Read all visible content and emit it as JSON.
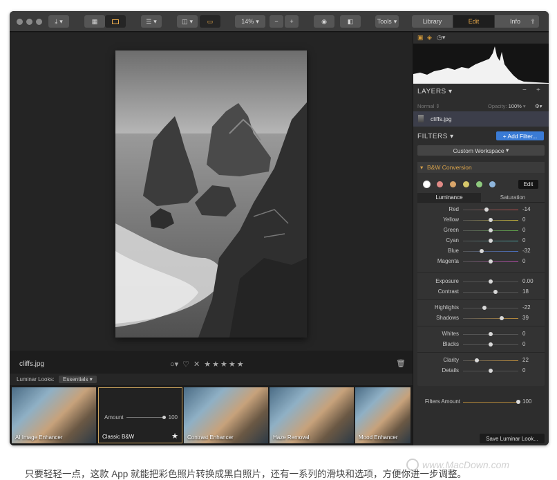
{
  "toolbar": {
    "zoom": "14%",
    "tools_label": "Tools",
    "view_tabs": [
      "Library",
      "Edit",
      "Info"
    ],
    "active_view": "Edit"
  },
  "photo": {
    "filename": "cliffs.jpg",
    "stars": 5
  },
  "looks": {
    "label": "Luminar Looks:",
    "category": "Essentials",
    "items": [
      {
        "name": "AI Image Enhancer",
        "type": "color"
      },
      {
        "name": "Classic B&W",
        "type": "bw",
        "amount_label": "Amount",
        "amount_value": "100",
        "favorite": true
      },
      {
        "name": "Contrast Enhancer",
        "type": "color"
      },
      {
        "name": "Haze Removal",
        "type": "color"
      },
      {
        "name": "Mood Enhancer",
        "type": "color"
      }
    ]
  },
  "layers": {
    "title": "LAYERS",
    "blend_mode": "Normal",
    "opacity_label": "Opacity:",
    "opacity_value": "100%",
    "layer_name": "cliffs.jpg"
  },
  "filters": {
    "title": "FILTERS",
    "add_button": "+ Add Filter...",
    "workspace": "Custom Workspace",
    "filter_name": "B&W Conversion",
    "edit_button": "Edit",
    "swatches": [
      "#ffffff",
      "#e08a86",
      "#d9a56a",
      "#d6c76a",
      "#8ec97e",
      "#8fb6dc"
    ],
    "tabs": [
      "Luminance",
      "Saturation"
    ],
    "luminance": [
      {
        "label": "Red",
        "value": -14,
        "min": -100,
        "max": 100,
        "color": "#c0504d"
      },
      {
        "label": "Yellow",
        "value": 0,
        "min": -100,
        "max": 100,
        "color": "#c7b53a"
      },
      {
        "label": "Green",
        "value": 0,
        "min": -100,
        "max": 100,
        "color": "#5fa54a"
      },
      {
        "label": "Cyan",
        "value": 0,
        "min": -100,
        "max": 100,
        "color": "#4aa5a5"
      },
      {
        "label": "Blue",
        "value": -32,
        "min": -100,
        "max": 100,
        "color": "#4a6fc0"
      },
      {
        "label": "Magenta",
        "value": 0,
        "min": -100,
        "max": 100,
        "color": "#b04aa5"
      }
    ],
    "tone": [
      {
        "label": "Exposure",
        "value": "0.00",
        "pos": 0.5
      },
      {
        "label": "Contrast",
        "value": "18",
        "pos": 0.59
      }
    ],
    "light": [
      {
        "label": "Highlights",
        "value": "-22",
        "pos": 0.39
      },
      {
        "label": "Shadows",
        "value": "39",
        "pos": 0.695
      }
    ],
    "levels": [
      {
        "label": "Whites",
        "value": "0",
        "pos": 0.5
      },
      {
        "label": "Blacks",
        "value": "0",
        "pos": 0.5
      }
    ],
    "detail": [
      {
        "label": "Clarity",
        "value": "22",
        "pos": 0.25
      },
      {
        "label": "Details",
        "value": "0",
        "pos": 0.5
      }
    ],
    "amount_label": "Filters Amount",
    "amount_value": "100",
    "amount_pos": 1.0,
    "save_look": "Save Luminar Look..."
  },
  "caption": "只要轻轻一点，这款 App 就能把彩色照片转换成黑白照片，还有一系列的滑块和选项，方便你进一步调整。",
  "watermark": "www.MacDown.com"
}
